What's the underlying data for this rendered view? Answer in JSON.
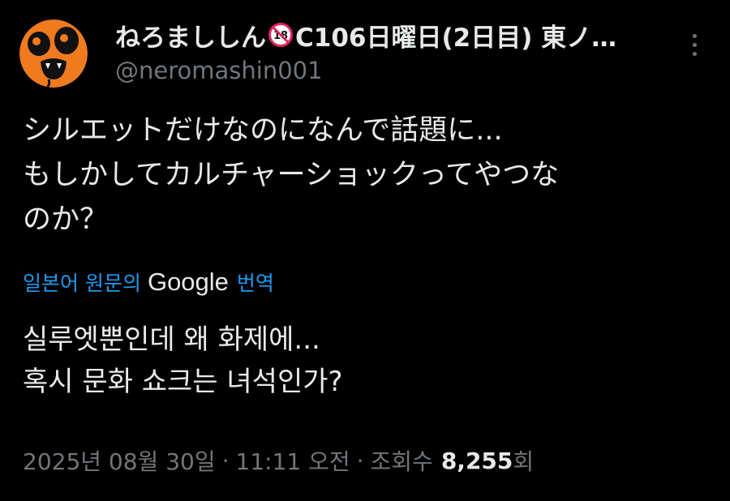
{
  "author": {
    "display_name_prefix": "ねろまししん",
    "display_name_suffix": "C106日曜日(2日目) 東ノ…",
    "badge_text": "18",
    "handle": "@neromashin001"
  },
  "tweet": {
    "lines": [
      "シルエットだけなのになんで話題に...",
      "もしかしてカルチャーショックってやつな",
      "のか？"
    ]
  },
  "translation": {
    "prefix": "일본어 원문의",
    "brand": "Google",
    "suffix": "번역",
    "lines": [
      "실루엣뿐인데 왜 화제에...",
      "혹시 문화 쇼크는 녀석인가?"
    ]
  },
  "meta": {
    "date": "2025년 08월 30일",
    "separator": "·",
    "time": "11:11 오전",
    "views_label": "조회수",
    "views_count": "8,255",
    "views_unit": "회"
  },
  "colors": {
    "background": "#000000",
    "text": "#e7e9ea",
    "muted": "#71767b",
    "link": "#1d9bf0",
    "avatar_orange": "#f07a1e",
    "no18_red": "#e0245e"
  },
  "icons": {
    "avatar": "orange-face-avatar",
    "badge": "no-under-18-icon",
    "more": "more-options-icon"
  }
}
